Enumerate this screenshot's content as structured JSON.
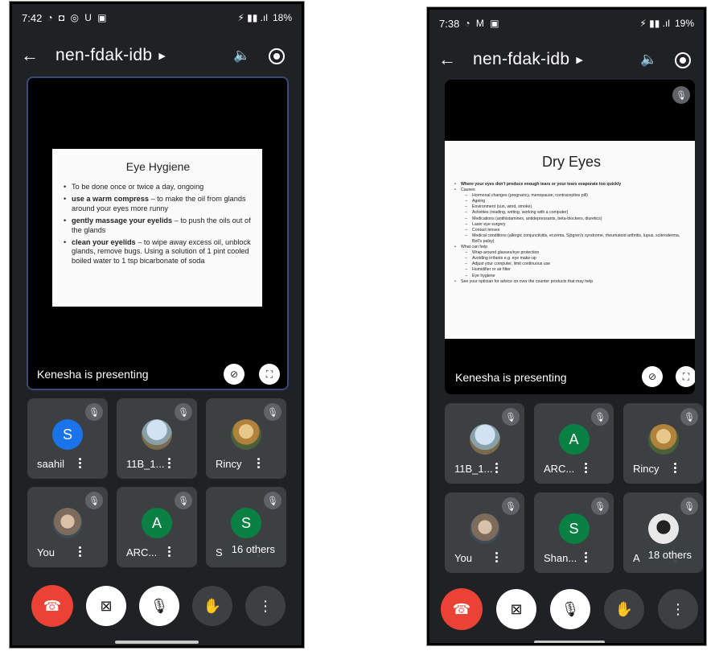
{
  "left": {
    "status": {
      "time": "7:42",
      "icons": "◔ ◘ ◎ U ▣",
      "signal": "⚡ ▮▮ .ıl",
      "battery": "18%"
    },
    "title": "nen-fdak-idb",
    "slide": {
      "title": "Eye Hygiene",
      "bullets": [
        {
          "bold": "",
          "text": "To be done once or twice a day, ongoing"
        },
        {
          "bold": "use a warm compress",
          "text": " – to make the oil from glands around your eyes more runny"
        },
        {
          "bold": "gently massage your eyelids",
          "text": " – to push the oils out of the glands"
        },
        {
          "bold": "clean your eyelids",
          "text": " – to wipe away excess oil, unblock glands, remove bugs. Using a solution of 1 pint cooled boiled water to 1 tsp bicarbonate of soda"
        }
      ]
    },
    "presenter": "Kenesha is presenting",
    "tiles": [
      {
        "name": "saahil",
        "initial": "S",
        "color": "#1a73e8"
      },
      {
        "name": "11B_1...",
        "initial": "",
        "color": ""
      },
      {
        "name": "Rincy",
        "initial": "",
        "color": ""
      },
      {
        "name": "You",
        "initial": "",
        "color": ""
      },
      {
        "name": "ARC...",
        "initial": "A",
        "color": "#0b8043"
      },
      {
        "name": "S",
        "initial": "S",
        "color": "#0b8043"
      }
    ],
    "others": "16 others"
  },
  "right": {
    "status": {
      "time": "7:38",
      "icons": "◔ M ▣",
      "signal": "⚡ ▮▮ .ıl",
      "battery": "19%"
    },
    "title": "nen-fdak-idb",
    "slide": {
      "title": "Dry Eyes",
      "lines": [
        {
          "level": 0,
          "bold": true,
          "text": "Where your eyes don't produce enough tears or your tears evaporate too quickly"
        },
        {
          "level": 0,
          "bold": false,
          "text": "Causes"
        },
        {
          "level": 1,
          "bold": false,
          "text": "Hormonal changes (pregnancy, menopause, contraceptive pill)"
        },
        {
          "level": 1,
          "bold": false,
          "text": "Ageing"
        },
        {
          "level": 1,
          "bold": false,
          "text": "Environment (sun, wind, smoke)"
        },
        {
          "level": 1,
          "bold": false,
          "text": "Activities (reading, writing, working with a computer)"
        },
        {
          "level": 1,
          "bold": false,
          "text": "Medications (antihistamines, antidepressants, beta-blockers, diuretics)"
        },
        {
          "level": 1,
          "bold": false,
          "text": "Laser eye surgery"
        },
        {
          "level": 1,
          "bold": false,
          "text": "Contact lenses"
        },
        {
          "level": 1,
          "bold": false,
          "text": "Medical conditions (allergic conjunctivitis, eczema, Sjögren's syndrome, rheumatoid arthritis, lupus, scleroderma, Bell's palsy)"
        },
        {
          "level": 0,
          "bold": false,
          "text": "What can help"
        },
        {
          "level": 1,
          "bold": false,
          "text": "Wrap-around glasses/eye protection"
        },
        {
          "level": 1,
          "bold": false,
          "text": "Avoiding irritants e.g. eye make-up"
        },
        {
          "level": 1,
          "bold": false,
          "text": "Adjust your computer, limit continuous use"
        },
        {
          "level": 1,
          "bold": false,
          "text": "Humidifier or air filter"
        },
        {
          "level": 1,
          "bold": false,
          "text": "Eye hygiene"
        },
        {
          "level": 0,
          "bold": false,
          "text": "See your optician for advice on over the counter products that may help"
        }
      ]
    },
    "presenter": "Kenesha is presenting",
    "tiles": [
      {
        "name": "11B_1...",
        "initial": "",
        "color": ""
      },
      {
        "name": "ARC...",
        "initial": "A",
        "color": "#0b8043"
      },
      {
        "name": "Rincy",
        "initial": "",
        "color": ""
      },
      {
        "name": "You",
        "initial": "",
        "color": ""
      },
      {
        "name": "Shan...",
        "initial": "S",
        "color": "#0b8043"
      },
      {
        "name": "A",
        "initial": "",
        "color": ""
      }
    ],
    "others": "18 others"
  },
  "icons": {
    "back": "back-arrow-icon",
    "dropdown": "caret-right-icon",
    "speaker": "speaker-icon",
    "camera_flip": "camera-switch-icon",
    "mic_off": "mic-off-icon",
    "pin_off": "pin-off-icon",
    "fullscreen": "fullscreen-icon",
    "more": "more-vert-icon",
    "end_call": "end-call-icon",
    "video_off": "video-off-icon",
    "hand": "raise-hand-icon"
  },
  "colors": {
    "background": "#202124",
    "tile": "#3c4043",
    "end_call": "#ea4335",
    "avatar_blue": "#1a73e8",
    "avatar_green": "#0b8043"
  }
}
